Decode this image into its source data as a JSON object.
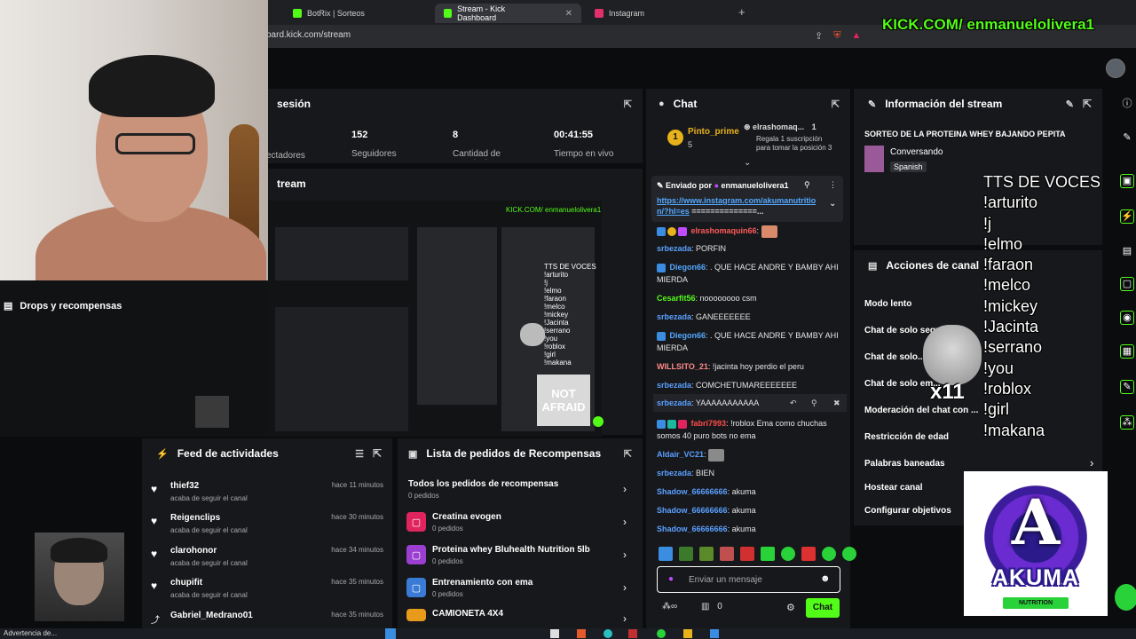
{
  "browser": {
    "tabs": [
      {
        "label": "BotRix | Sorteos",
        "active": false
      },
      {
        "label": "Stream - Kick Dashboard",
        "active": true
      },
      {
        "label": "Instagram",
        "active": false
      }
    ],
    "url": "oard.kick.com/stream"
  },
  "overlay": {
    "kick_handle": "KICK.COM/ enmanuelolivera1",
    "tts_text": "TTS DE VOCES\n!arturito\n!j\n!elmo\n!faraon\n!melco\n!mickey\n!Jacinta\n!serrano\n!you\n!roblox\n!girl\n!makana",
    "cat_multiplier": "x11",
    "logo_text": "AKUMA",
    "logo_sub": "NUTRITION"
  },
  "session": {
    "title": "sesión",
    "stats": [
      {
        "value": "",
        "label": "ectadores"
      },
      {
        "value": "152",
        "label": "Seguidores"
      },
      {
        "value": "8",
        "label": "Cantidad de suscripciones"
      },
      {
        "value": "00:41:55",
        "label": "Tiempo en vivo"
      }
    ]
  },
  "stream_preview": {
    "title": "tream",
    "pv_kick": "KICK.COM/ enmanuelolivera1",
    "not_afraid": "NOT AFRAID"
  },
  "drops": {
    "label": "Drops y recompensas"
  },
  "feed": {
    "title": "Feed de actividades",
    "items": [
      {
        "name": "thief32",
        "sub": "acaba de seguir el canal",
        "time": "hace 11 minutos"
      },
      {
        "name": "Reigenclips",
        "sub": "acaba de seguir el canal",
        "time": "hace 30 minutos"
      },
      {
        "name": "clarohonor",
        "sub": "acaba de seguir el canal",
        "time": "hace 34 minutos"
      },
      {
        "name": "chupifit",
        "sub": "acaba de seguir el canal",
        "time": "hace 35 minutos"
      },
      {
        "name": "Gabriel_Medrano01",
        "sub": "",
        "time": "hace 35 minutos"
      }
    ]
  },
  "rewards": {
    "title": "Lista de pedidos de Recompensas",
    "all": {
      "title": "Todos los pedidos de recompensas",
      "sub": "0 pedidos"
    },
    "items": [
      {
        "title": "Creatina evogen",
        "sub": "0 pedidos",
        "color": "#e0245e"
      },
      {
        "title": "Proteina whey Bluhealth Nutrition 5lb",
        "sub": "0 pedidos",
        "color": "#9b3fd1"
      },
      {
        "title": "Entrenamiento con ema",
        "sub": "0 pedidos",
        "color": "#3a7bd5"
      },
      {
        "title": "CAMIONETA 4X4",
        "sub": "",
        "color": "#e89a1b"
      }
    ]
  },
  "chat": {
    "title": "Chat",
    "top_gifter": {
      "name": "Pinto_prime",
      "count": "5"
    },
    "gift_user": "elrashomaq...",
    "gift_count": "1",
    "gift_text": "Regala 1 suscripción para tomar la posición 3",
    "pinned": {
      "by_label": "Enviado por",
      "by_user": "enmanuelolivera1",
      "link": "https://www.instagram.com/akumanutrition/?hl=es",
      "suffix": " ==============..."
    },
    "messages": [
      {
        "user": "elrashomaquin66",
        "text": "",
        "color": "#ff5a5a"
      },
      {
        "user": "srbezada",
        "text": "PORFIN",
        "color": "#5aa0ff"
      },
      {
        "user": "Diegon66",
        "text": ". QUE HACE ANDRE Y BAMBY AHI MIERDA",
        "color": "#53a8ff"
      },
      {
        "user": "Cesarfit56",
        "text": "noooooooo csm",
        "color": "#53fc18"
      },
      {
        "user": "srbezada",
        "text": "GANEEEEEEE",
        "color": "#5aa0ff"
      },
      {
        "user": "Diegon66",
        "text": ". QUE HACE ANDRE Y BAMBY AHI MIERDA",
        "color": "#53a8ff"
      },
      {
        "user": "WILLSITO_21",
        "text": "!jacinta hoy perdio el peru",
        "color": "#ff8a8a"
      },
      {
        "user": "srbezada",
        "text": "COMCHETUMAREEEEEEE",
        "color": "#5aa0ff"
      },
      {
        "user": "srbezada",
        "text": "YAAAAAAAAAAA",
        "color": "#5aa0ff"
      },
      {
        "user": "fabri7993",
        "text": "!roblox Ema como chuchas somos 40 puro bots no ema",
        "color": "#ff4a4a"
      },
      {
        "user": "Aldair_VC21",
        "text": "",
        "color": "#5aa0ff"
      },
      {
        "user": "srbezada",
        "text": "BIEN",
        "color": "#5aa0ff"
      },
      {
        "user": "Shadow_66666666",
        "text": "akuma",
        "color": "#5aa0ff"
      },
      {
        "user": "Shadow_66666666",
        "text": "akuma",
        "color": "#5aa0ff"
      },
      {
        "user": "Shadow_66666666",
        "text": "akuma",
        "color": "#5aa0ff"
      }
    ],
    "input_placeholder": "Enviar un mensaje",
    "points": "0",
    "send_label": "Chat"
  },
  "stream_info": {
    "title": "Información del stream",
    "stream_title": "SORTEO DE LA PROTEINA WHEY BAJANDO PEPITA",
    "category": "Conversando",
    "language": "Spanish"
  },
  "channel_actions": {
    "title": "Acciones de canal",
    "items": [
      "Modo lento",
      "Chat de solo seguidores",
      "Chat de solo...",
      "Chat de solo em...",
      "Moderación del chat con ...",
      "Restricción de edad",
      "Palabras baneadas",
      "Hostear canal",
      "Configurar objetivos"
    ]
  },
  "taskbar": {
    "warning": "Advertencia de..."
  },
  "colors": {
    "accent": "#53fc18",
    "panel": "#17181b",
    "background": "#0b0c0e"
  }
}
